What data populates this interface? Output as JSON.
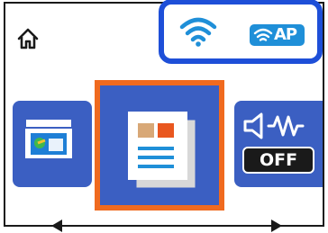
{
  "status_bar": {
    "home_icon": "home-icon",
    "wifi_icon": "wifi-icon",
    "wifi_ap_label": "AP",
    "highlight_color": "#1e4fd8",
    "wifi_color": "#1f8fd8"
  },
  "menu": {
    "items": [
      {
        "name": "scan-to-computer",
        "icon": "scan-icon"
      },
      {
        "name": "document",
        "icon": "document-icon",
        "selected": true
      },
      {
        "name": "sound",
        "icon": "speaker-icon",
        "value": "OFF"
      }
    ],
    "tile_color": "#3b5fc2",
    "selection_color": "#f06a1f"
  },
  "navigation": {
    "prev_icon": "arrow-left-icon",
    "next_icon": "arrow-right-icon"
  }
}
